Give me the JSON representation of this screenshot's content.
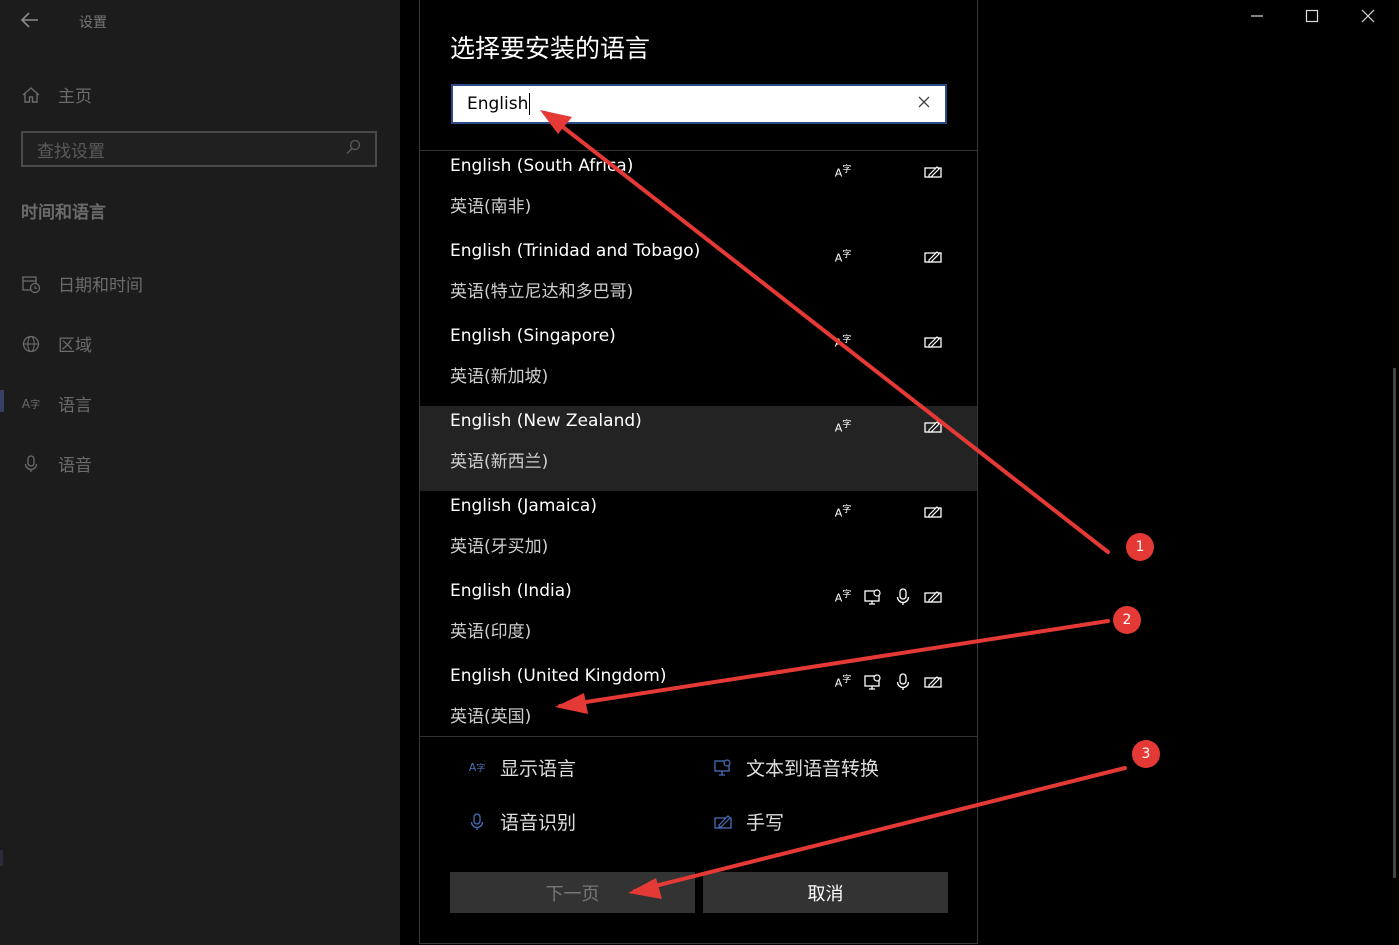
{
  "settings": {
    "app_title": "设置",
    "home_label": "主页",
    "search_placeholder": "查找设置",
    "section_title": "时间和语言",
    "nav": [
      {
        "label": "日期和时间",
        "icon": "calendar-clock-icon"
      },
      {
        "label": "区域",
        "icon": "globe-icon"
      },
      {
        "label": "语言",
        "icon": "language-icon"
      },
      {
        "label": "语音",
        "icon": "microphone-icon"
      }
    ]
  },
  "dialog": {
    "title": "选择要安装的语言",
    "search_value": "English",
    "languages": [
      {
        "en": "English (South Africa)",
        "cn": "英语(南非)",
        "features": [
          "display",
          "handwriting"
        ]
      },
      {
        "en": "English (Trinidad and Tobago)",
        "cn": "英语(特立尼达和多巴哥)",
        "features": [
          "display",
          "handwriting"
        ]
      },
      {
        "en": "English (Singapore)",
        "cn": "英语(新加坡)",
        "features": [
          "display",
          "handwriting"
        ]
      },
      {
        "en": "English (New Zealand)",
        "cn": "英语(新西兰)",
        "features": [
          "display",
          "handwriting"
        ]
      },
      {
        "en": "English (Jamaica)",
        "cn": "英语(牙买加)",
        "features": [
          "display",
          "handwriting"
        ]
      },
      {
        "en": "English (India)",
        "cn": "英语(印度)",
        "features": [
          "display",
          "tts",
          "speech",
          "handwriting"
        ]
      },
      {
        "en": "English (United Kingdom)",
        "cn": "英语(英国)",
        "features": [
          "display",
          "tts",
          "speech",
          "handwriting"
        ]
      }
    ],
    "legend": {
      "display": "显示语言",
      "tts": "文本到语音转换",
      "speech": "语音识别",
      "handwriting": "手写"
    },
    "next_label": "下一页",
    "cancel_label": "取消"
  },
  "annotations": [
    "1",
    "2",
    "3"
  ],
  "colors": {
    "accent_arrow": "#e53935",
    "search_border": "#2a4a8a"
  }
}
